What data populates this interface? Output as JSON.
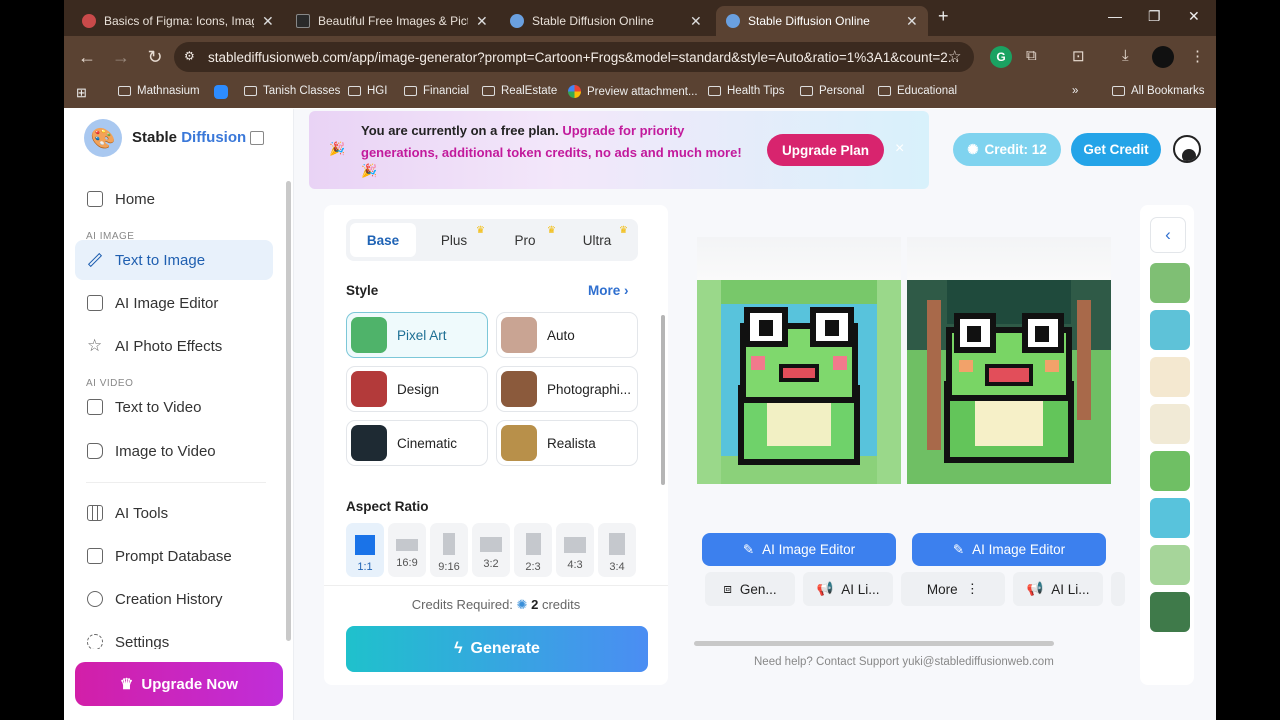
{
  "browser": {
    "tabs": [
      {
        "title": "Basics of Figma: Icons, Images,",
        "color": "#c94a4a"
      },
      {
        "title": "Beautiful Free Images & Picture",
        "color": "#2a2a2a"
      },
      {
        "title": "Stable Diffusion Online",
        "color": "#6aa0e0"
      },
      {
        "title": "Stable Diffusion Online",
        "color": "#6aa0e0"
      }
    ],
    "url": "stablediffusionweb.com/app/image-generator?prompt=Cartoon+Frogs&model=standard&style=Auto&ratio=1%3A1&count=2...",
    "bookmarks": [
      "Mathnasium",
      "Tanish Classes",
      "HGI",
      "Financial",
      "RealEstate",
      "Preview attachment...",
      "Health Tips",
      "Personal",
      "Educational"
    ],
    "all_bookmarks": "All Bookmarks"
  },
  "sidebar": {
    "brand_first": "Stable",
    "brand_second": "Diffusion",
    "home": "Home",
    "section_image": "AI IMAGE",
    "text_to_image": "Text to Image",
    "ai_image_editor": "AI Image Editor",
    "ai_photo_effects": "AI Photo Effects",
    "section_video": "AI VIDEO",
    "text_to_video": "Text to Video",
    "image_to_video": "Image to Video",
    "ai_tools": "AI Tools",
    "prompt_database": "Prompt Database",
    "creation_history": "Creation History",
    "settings": "Settings",
    "upgrade_now": "Upgrade Now"
  },
  "banner": {
    "text_plain": "You are currently on a free plan. ",
    "text_highlight": "Upgrade for priority generations, additional token credits, no ads and much more!",
    "upgrade_plan": "Upgrade Plan",
    "close": "×"
  },
  "header": {
    "credit": "Credit: 12",
    "get_credit": "Get Credit"
  },
  "form": {
    "tiers": [
      "Base",
      "Plus",
      "Pro",
      "Ultra"
    ],
    "style_label": "Style",
    "more": "More",
    "styles": [
      {
        "label": "Pixel Art",
        "color": "#4fb36a"
      },
      {
        "label": "Auto",
        "color": "#c9a493"
      },
      {
        "label": "Design",
        "color": "#b33a3a"
      },
      {
        "label": "Photographi...",
        "color": "#8b5a3c"
      },
      {
        "label": "Cinematic",
        "color": "#1e2a33"
      },
      {
        "label": "Realista",
        "color": "#b8904a"
      }
    ],
    "aspect_label": "Aspect Ratio",
    "ratios": [
      "1:1",
      "16:9",
      "9:16",
      "3:2",
      "2:3",
      "4:3",
      "3:4"
    ],
    "credits_required_label": "Credits Required:",
    "credits_value": "2",
    "credits_unit": "credits",
    "generate": "Generate"
  },
  "results": {
    "edit_label": "AI Image Editor",
    "buttons": [
      "Gen...",
      "AI Li...",
      "More",
      "AI Li..."
    ],
    "help": "Need help? Contact Support yuki@stablediffusionweb.com"
  }
}
